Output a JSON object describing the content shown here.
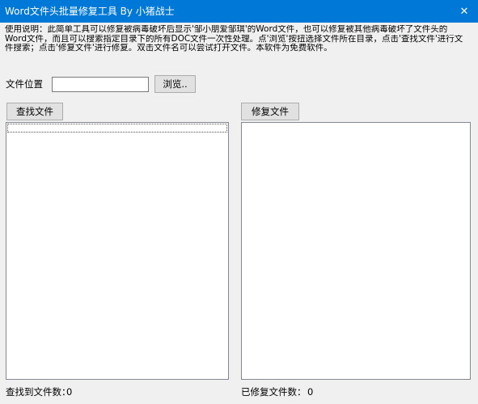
{
  "window": {
    "title": "Word文件头批量修复工具  By 小猪战士",
    "close_glyph": "✕"
  },
  "instructions": {
    "line1": "使用说明：此简单工具可以修复被病毒破坏后显示'邹小朋爱邹琪'的Word文件，也可以修复被其他病毒破坏了文件头的",
    "line2": "Word文件，而且可以搜索指定目录下的所有DOC文件一次性处理。点'浏览'按扭选择文件所在目录，点击'查找文件'进行文",
    "line3": "件搜索；点击'修复文件'进行修复。双击文件名可以尝试打开文件。本软件为免费软件。"
  },
  "location": {
    "label": "文件位置",
    "value": "",
    "browse_label": "浏览.."
  },
  "left_panel": {
    "button_label": "查找文件",
    "status_label": "查找到文件数：",
    "count": "0"
  },
  "right_panel": {
    "button_label": "修复文件",
    "status_label": "已修复文件数：",
    "count": "0"
  }
}
